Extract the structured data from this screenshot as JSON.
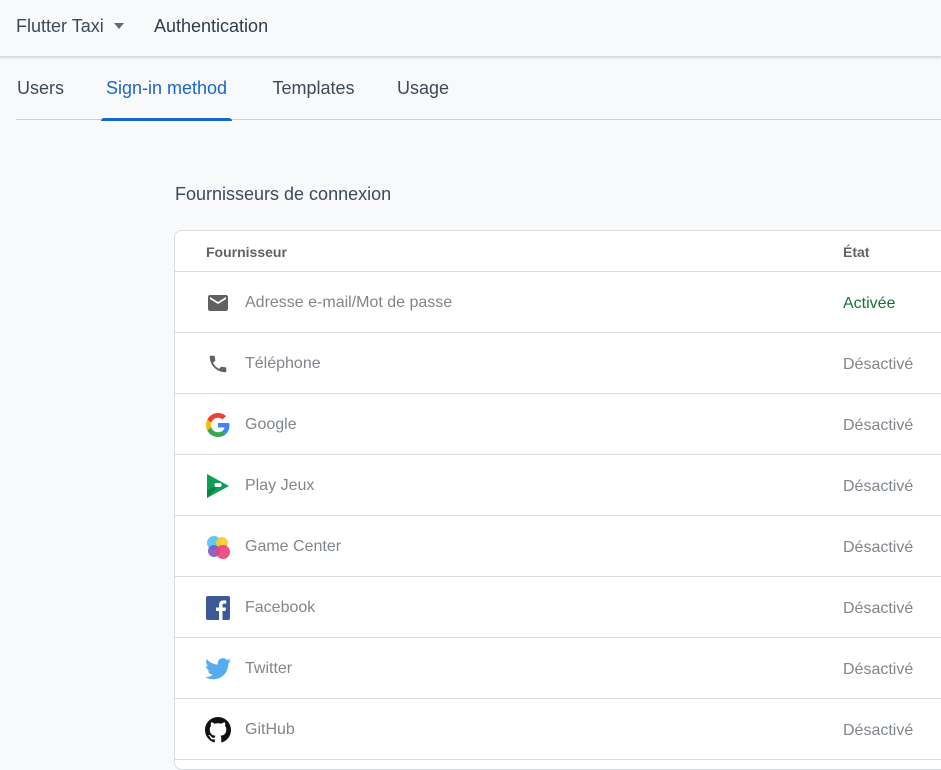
{
  "header": {
    "project_name": "Flutter Taxi",
    "section": "Authentication"
  },
  "tabs": [
    {
      "label": "Users",
      "active": false
    },
    {
      "label": "Sign-in method",
      "active": true
    },
    {
      "label": "Templates",
      "active": false
    },
    {
      "label": "Usage",
      "active": false
    }
  ],
  "providers_section": {
    "heading": "Fournisseurs de connexion",
    "columns": {
      "provider": "Fournisseur",
      "state": "État"
    },
    "rows": [
      {
        "icon": "email-icon",
        "name": "Adresse e-mail/Mot de passe",
        "state": "Activée",
        "enabled": true
      },
      {
        "icon": "phone-icon",
        "name": "Téléphone",
        "state": "Désactivé",
        "enabled": false
      },
      {
        "icon": "google-icon",
        "name": "Google",
        "state": "Désactivé",
        "enabled": false
      },
      {
        "icon": "play-games-icon",
        "name": "Play Jeux",
        "state": "Désactivé",
        "enabled": false
      },
      {
        "icon": "game-center-icon",
        "name": "Game Center",
        "state": "Désactivé",
        "enabled": false
      },
      {
        "icon": "facebook-icon",
        "name": "Facebook",
        "state": "Désactivé",
        "enabled": false
      },
      {
        "icon": "twitter-icon",
        "name": "Twitter",
        "state": "Désactivé",
        "enabled": false
      },
      {
        "icon": "github-icon",
        "name": "GitHub",
        "state": "Désactivé",
        "enabled": false
      }
    ]
  },
  "colors": {
    "accent": "#1a66c8",
    "enabled": "#137333",
    "disabled_text": "#80868b"
  }
}
